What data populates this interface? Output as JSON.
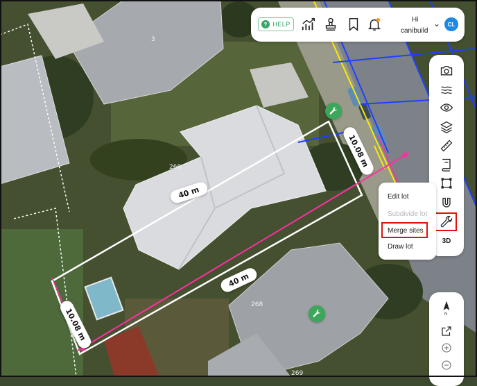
{
  "map": {
    "lot_numbers": [
      "3",
      "266",
      "268",
      "269"
    ],
    "dimensions": {
      "top_width": "40 m",
      "bottom_width": "40 m",
      "right_depth": "10.08 m",
      "left_depth": "10.08 m"
    },
    "colors": {
      "lot_boundary": "#ffffff",
      "measure_line": "#ff2fa3",
      "road_blue": "#1f3fff",
      "road_yellow": "#ffe800",
      "pin": "#3aa75a"
    }
  },
  "topbar": {
    "help_label": "HELP",
    "icons": [
      "chart-icon",
      "planning-stamp-icon",
      "bookmark-icon",
      "notification-bell-icon"
    ],
    "greeting": "Hi",
    "username": "canibuild",
    "avatar_initials": "CL"
  },
  "tool_rail": {
    "buttons": [
      "camera-icon",
      "water-icon",
      "eye-icon",
      "layers-icon",
      "ruler-icon",
      "book-icon",
      "select-box-icon",
      "magnet-icon",
      "wrench-icon"
    ],
    "three_d_label": "3D"
  },
  "tools_menu": {
    "items": [
      {
        "label": "Edit lot",
        "enabled": true
      },
      {
        "label": "Subdivide lot",
        "enabled": false
      },
      {
        "label": "Merge sites",
        "enabled": true
      },
      {
        "label": "Draw lot",
        "enabled": true
      }
    ]
  },
  "nav_rail": {
    "north_label": "N",
    "buttons": [
      "north-arrow-icon",
      "external-link-icon",
      "zoom-in-icon",
      "zoom-out-icon"
    ]
  }
}
